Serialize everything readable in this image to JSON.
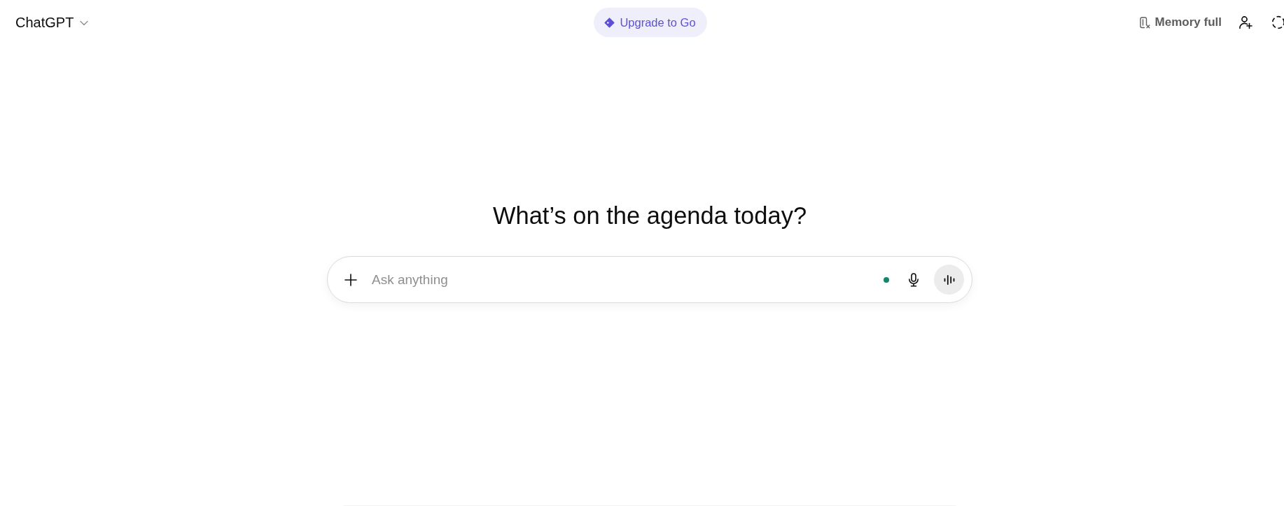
{
  "header": {
    "model_menu": {
      "label": "ChatGPT"
    },
    "upgrade_button": {
      "label": "Upgrade to Go"
    },
    "memory_status": {
      "label": "Memory full"
    }
  },
  "main": {
    "heading": "What’s on the agenda today?",
    "composer": {
      "placeholder": "Ask anything"
    }
  }
}
